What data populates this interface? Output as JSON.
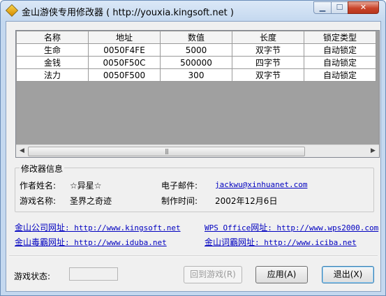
{
  "window": {
    "title": "金山游侠专用修改器 ( http://youxia.kingsoft.net )",
    "min_glyph": "▁",
    "max_glyph": "☐",
    "close_glyph": "✕"
  },
  "table": {
    "columns": [
      "名称",
      "地址",
      "数值",
      "长度",
      "锁定类型"
    ],
    "rows": [
      [
        "生命",
        "0050F4FE",
        "5000",
        "双字节",
        "自动锁定"
      ],
      [
        "金钱",
        "0050F50C",
        "500000",
        "四字节",
        "自动锁定"
      ],
      [
        "法力",
        "0050F500",
        "300",
        "双字节",
        "自动锁定"
      ]
    ],
    "scroll_left": "◀",
    "scroll_right": "▶",
    "thumb_grip": "|||"
  },
  "info": {
    "legend": "修改器信息",
    "author_label": "作者姓名:",
    "author_value": "☆异星☆",
    "email_label": "电子邮件:",
    "email_value": "jackwu@xinhuanet.com",
    "game_label": "游戏名称:",
    "game_value": "圣界之奇迹",
    "date_label": "制作时间:",
    "date_value": "2002年12月6日"
  },
  "links": {
    "kingsoft_prefix": "金山公司网址",
    "kingsoft_url": ": http://www.kingsoft.net",
    "wps_prefix_a": "WPS Office",
    "wps_prefix_b": "网址",
    "wps_url": ": http://www.wps2000.com",
    "duba_prefix": "金山毒霸网址",
    "duba_url": ": http://www.iduba.net",
    "iciba_prefix": "金山词霸网址",
    "iciba_url": ": http://www.iciba.net"
  },
  "footer": {
    "status_label": "游戏状态:",
    "back_button": "回到游戏(R)",
    "apply_button": "应用(A)",
    "exit_button": "退出(X)"
  }
}
